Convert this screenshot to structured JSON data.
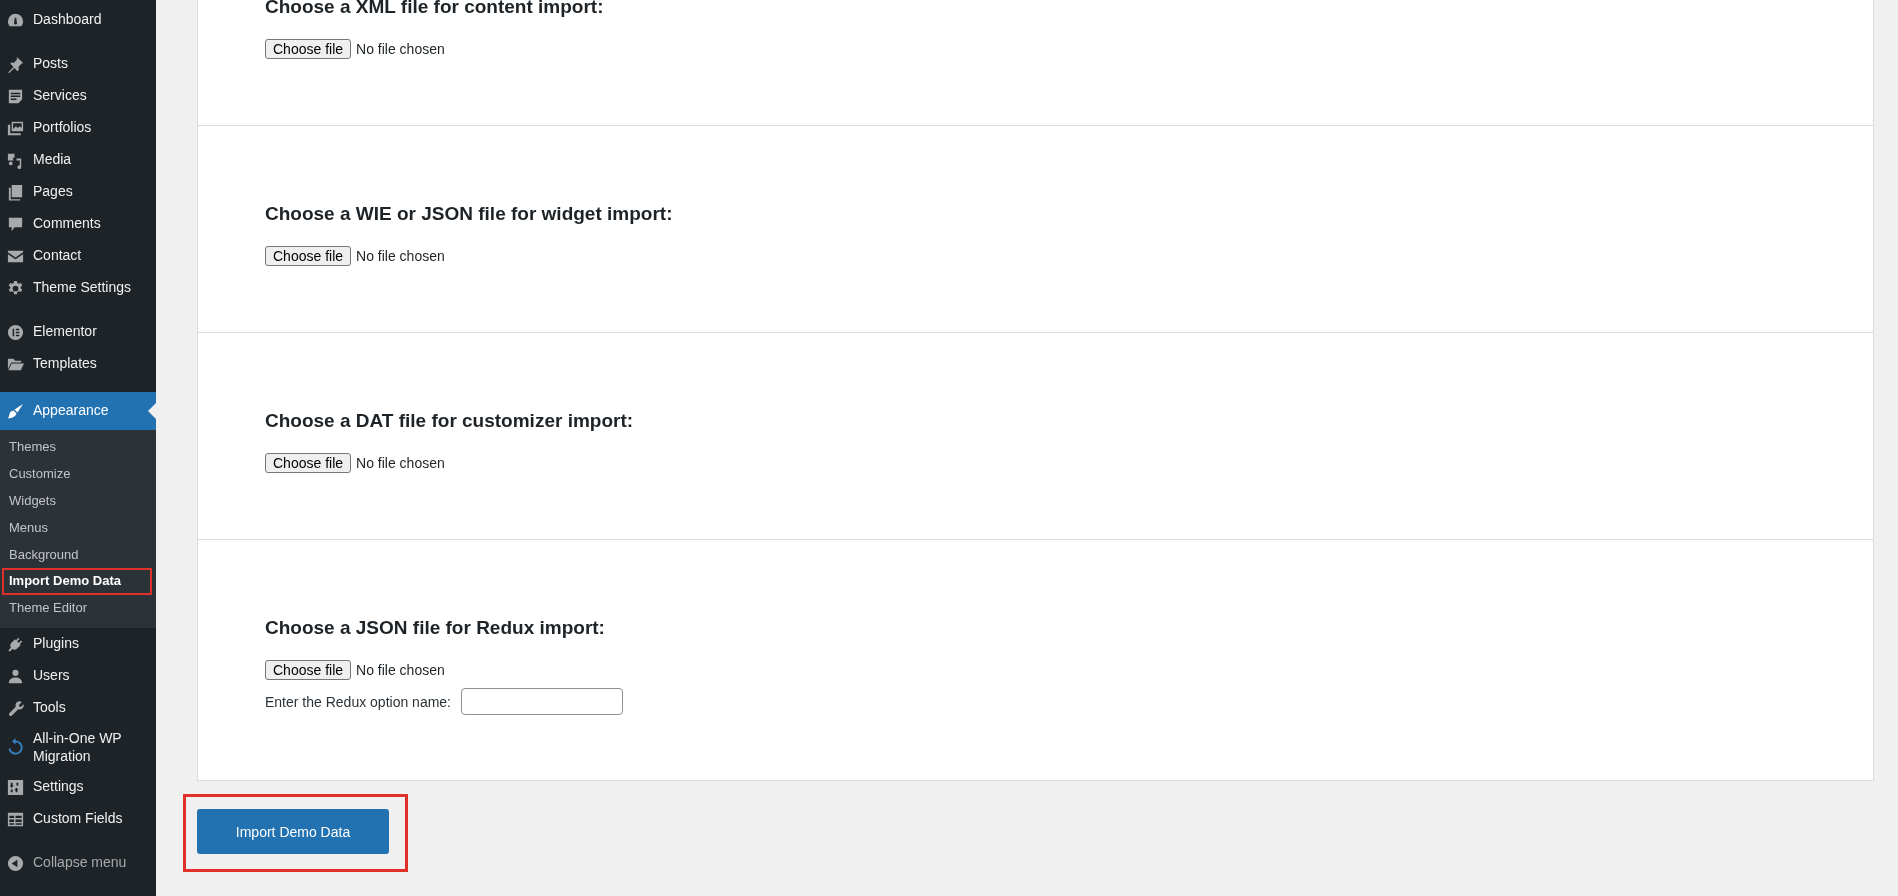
{
  "sidebar": {
    "menu_groups": [
      [
        {
          "label": "Dashboard",
          "selected": false
        }
      ],
      [
        {
          "label": "Posts",
          "selected": false
        },
        {
          "label": "Services",
          "selected": false
        },
        {
          "label": "Portfolios",
          "selected": false
        },
        {
          "label": "Media",
          "selected": false
        },
        {
          "label": "Pages",
          "selected": false
        },
        {
          "label": "Comments",
          "selected": false
        },
        {
          "label": "Contact",
          "selected": false
        },
        {
          "label": "Theme Settings",
          "selected": false
        }
      ],
      [
        {
          "label": "Elementor",
          "selected": false
        },
        {
          "label": "Templates",
          "selected": false
        }
      ],
      [
        {
          "label": "Appearance",
          "selected": true,
          "submenu": [
            {
              "label": "Themes",
              "selected": false,
              "highlighted": false
            },
            {
              "label": "Customize",
              "selected": false,
              "highlighted": false
            },
            {
              "label": "Widgets",
              "selected": false,
              "highlighted": false
            },
            {
              "label": "Menus",
              "selected": false,
              "highlighted": false
            },
            {
              "label": "Background",
              "selected": false,
              "highlighted": false
            },
            {
              "label": "Import Demo Data",
              "selected": true,
              "highlighted": true
            },
            {
              "label": "Theme Editor",
              "selected": false,
              "highlighted": false
            }
          ]
        },
        {
          "label": "Plugins",
          "selected": false
        },
        {
          "label": "Users",
          "selected": false
        },
        {
          "label": "Tools",
          "selected": false
        },
        {
          "label": "All-in-One WP Migration",
          "selected": false
        },
        {
          "label": "Settings",
          "selected": false
        },
        {
          "label": "Custom Fields",
          "selected": false
        }
      ]
    ],
    "collapse": "Collapse menu"
  },
  "import_sections": [
    {
      "heading": "Choose a XML file for content import:",
      "file_button": "Choose file",
      "file_status": "No file chosen"
    },
    {
      "heading": "Choose a WIE or JSON file for widget import:",
      "file_button": "Choose file",
      "file_status": "No file chosen"
    },
    {
      "heading": "Choose a DAT file for customizer import:",
      "file_button": "Choose file",
      "file_status": "No file chosen"
    },
    {
      "heading": "Choose a JSON file for Redux import:",
      "file_button": "Choose file",
      "file_status": "No file chosen",
      "option_field": {
        "label": "Enter the Redux option name:"
      }
    }
  ],
  "import_button": {
    "label": "Import Demo Data",
    "highlighted": true
  }
}
